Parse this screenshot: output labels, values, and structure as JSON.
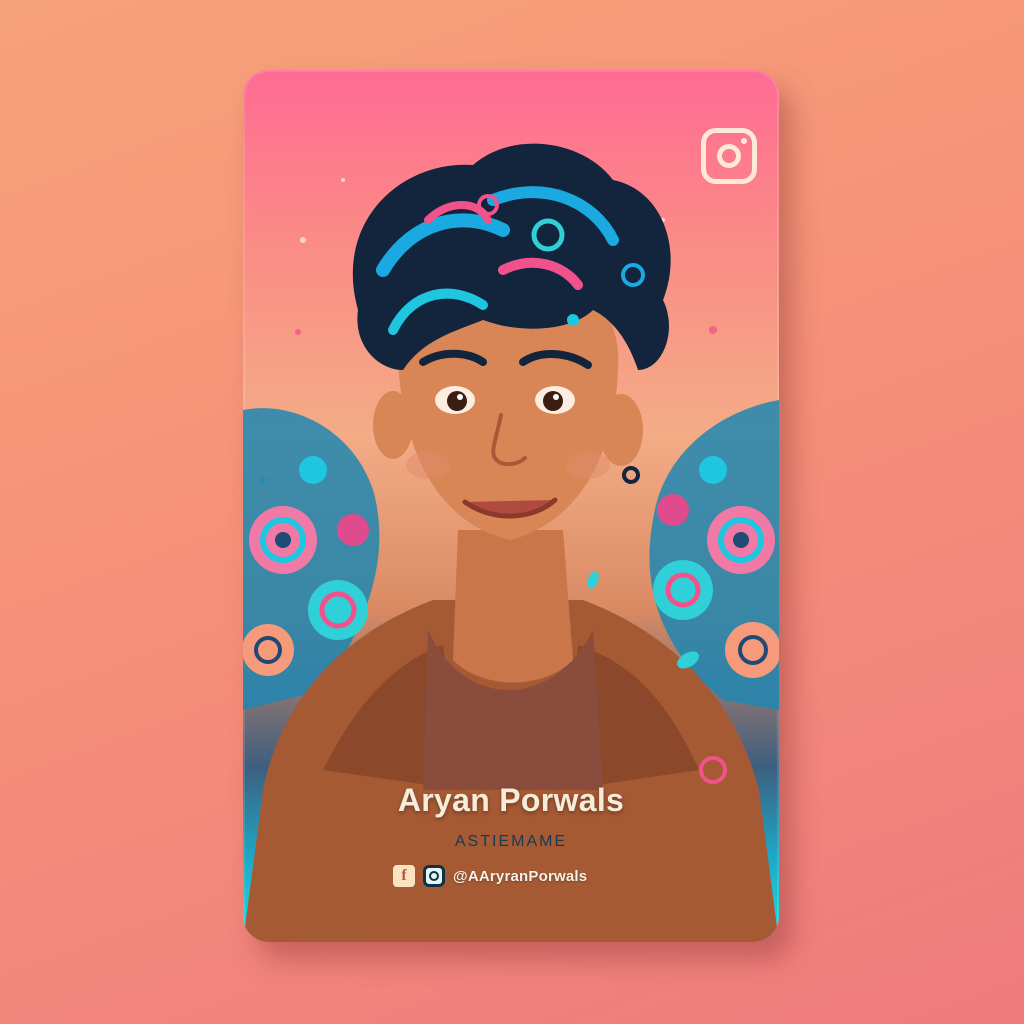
{
  "card": {
    "name": "Aryan Porwals",
    "subtitle": "ASTIEMAME",
    "handle": "@AAryranPorwals",
    "icons": {
      "corner": "instagram-icon",
      "social": [
        "facebook-icon",
        "instagram-icon"
      ],
      "facebook_glyph": "f"
    },
    "colors": {
      "top": "#ff6b93",
      "bottom": "#1ae3df",
      "hair": "#13243d",
      "hair_accent_blue": "#1aa9e0",
      "hair_accent_pink": "#f2528c",
      "skin": "#d98656",
      "jacket": "#a65a34"
    }
  }
}
